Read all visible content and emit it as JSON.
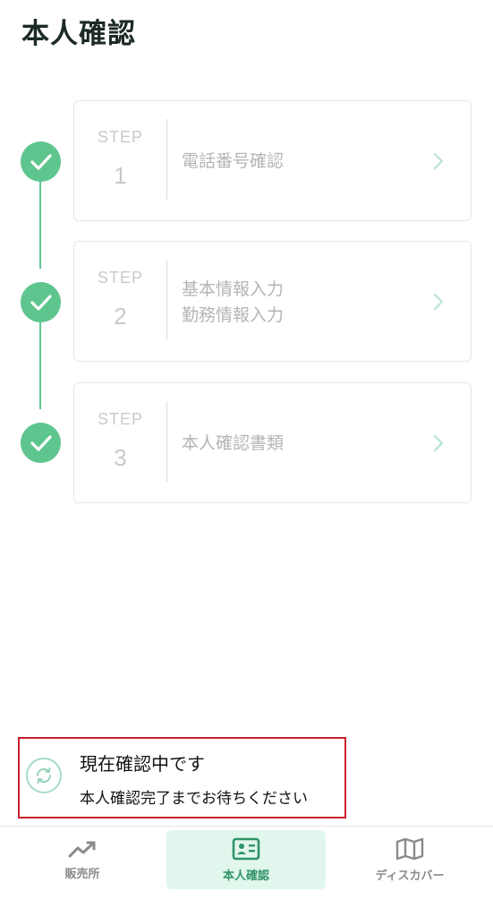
{
  "header": {
    "title": "本人確認"
  },
  "steps": [
    {
      "tag": "STEP",
      "number": "1",
      "lines": [
        "電話番号確認"
      ],
      "status": "complete"
    },
    {
      "tag": "STEP",
      "number": "2",
      "lines": [
        "基本情報入力",
        "勤務情報入力"
      ],
      "status": "complete"
    },
    {
      "tag": "STEP",
      "number": "3",
      "lines": [
        "本人確認書類"
      ],
      "status": "complete"
    }
  ],
  "status_banner": {
    "title": "現在確認中です",
    "message": "本人確認完了までお待ちください",
    "icon": "sync-icon"
  },
  "bottom_nav": {
    "items": [
      {
        "label": "販売所",
        "icon": "trend-up-icon",
        "active": false
      },
      {
        "label": "本人確認",
        "icon": "id-card-icon",
        "active": true
      },
      {
        "label": "ディスカバー",
        "icon": "map-icon",
        "active": false
      }
    ]
  },
  "colors": {
    "accent": "#5fc58f",
    "nav_active_bg": "#e1f6ec",
    "nav_active_text": "#2f9468",
    "highlight_border": "#c8202a"
  }
}
